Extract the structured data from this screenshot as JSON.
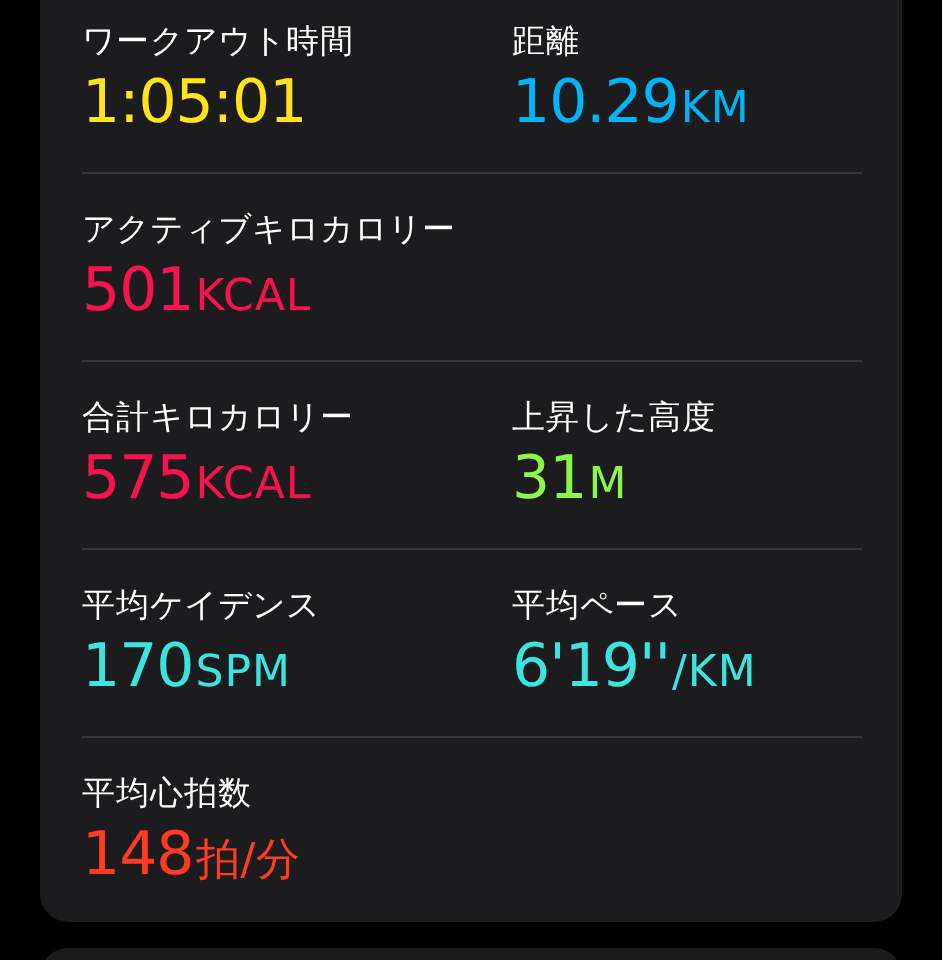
{
  "workout_summary": {
    "rows": [
      {
        "metrics": [
          {
            "label": "ワークアウト時間",
            "value": "1:05:01",
            "color": "#ffe419"
          },
          {
            "label": "距離",
            "value": "10.29",
            "unit": "KM",
            "color": "#00b4f5"
          }
        ]
      },
      {
        "metrics": [
          {
            "label": "アクティブキロカロリー",
            "value": "501",
            "unit": "KCAL",
            "color": "#fa1150"
          }
        ]
      },
      {
        "metrics": [
          {
            "label": "合計キロカロリー",
            "value": "575",
            "unit": "KCAL",
            "color": "#fa1150"
          },
          {
            "label": "上昇した高度",
            "value": "31",
            "unit": "M",
            "color": "#8cf74a"
          }
        ]
      },
      {
        "metrics": [
          {
            "label": "平均ケイデンス",
            "value": "170",
            "unit": "SPM",
            "color": "#3ae5e0"
          },
          {
            "label": "平均ペース",
            "value": "6'19''",
            "unit": "/KM",
            "color": "#3ae5e0"
          }
        ]
      },
      {
        "metrics": [
          {
            "label": "平均心拍数",
            "value": "148",
            "unit": "拍/分",
            "color": "#ff3b21"
          }
        ]
      }
    ]
  }
}
